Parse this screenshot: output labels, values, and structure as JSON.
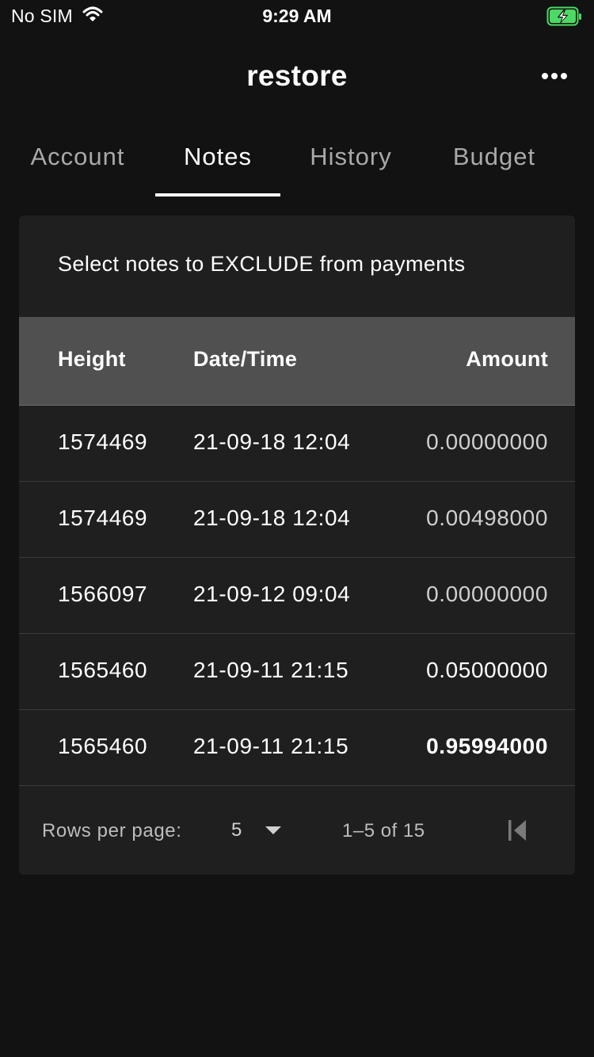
{
  "status_bar": {
    "carrier": "No SIM",
    "time": "9:29 AM",
    "wifi_icon": "wifi-icon",
    "battery_icon": "battery-charging-icon",
    "battery_color": "#4cd964"
  },
  "app_bar": {
    "title": "restore",
    "menu_icon": "more-horizontal-icon"
  },
  "tabs": [
    {
      "label": "Account",
      "active": false
    },
    {
      "label": "Notes",
      "active": true
    },
    {
      "label": "History",
      "active": false
    },
    {
      "label": "Budget",
      "active": false
    }
  ],
  "notes_card": {
    "heading": "Select notes to EXCLUDE from payments",
    "columns": [
      "Height",
      "Date/Time",
      "Amount"
    ],
    "rows": [
      {
        "height": "1574469",
        "datetime": "21-09-18 12:04",
        "amount": "0.00000000"
      },
      {
        "height": "1574469",
        "datetime": "21-09-18 12:04",
        "amount": "0.00498000"
      },
      {
        "height": "1566097",
        "datetime": "21-09-12 09:04",
        "amount": "0.00000000"
      },
      {
        "height": "1565460",
        "datetime": "21-09-11 21:15",
        "amount": "0.05000000"
      },
      {
        "height": "1565460",
        "datetime": "21-09-11 21:15",
        "amount": "0.95994000"
      }
    ],
    "pagination": {
      "rows_per_page_label": "Rows per page:",
      "rows_per_page_value": "5",
      "range": "1–5 of 15"
    }
  },
  "colors": {
    "background": "#121212",
    "card": "#1f1f1f",
    "table_header": "#505050"
  }
}
